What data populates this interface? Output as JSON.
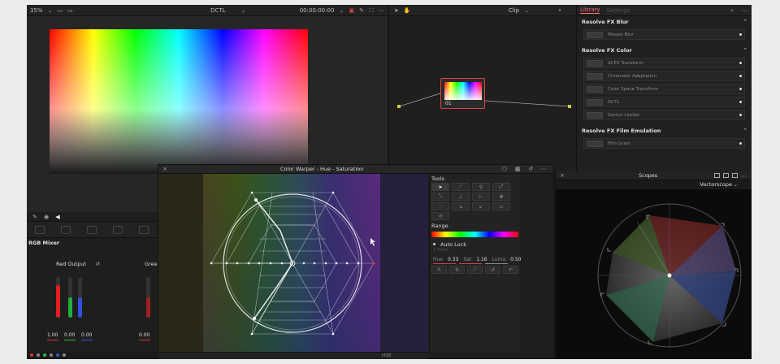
{
  "viewer": {
    "zoom": "35%",
    "title": "DCTL",
    "timecode": "00:00:00:00"
  },
  "nodes": {
    "title": "Clip",
    "node_label": "01"
  },
  "library": {
    "tab_active": "Library",
    "tab_inactive": "Settings",
    "sections": [
      {
        "title": "Resolve FX Blur",
        "items": [
          "Mosaic Blur"
        ]
      },
      {
        "title": "Resolve FX Color",
        "items": [
          "ACES Transform",
          "Chromatic Adaptation",
          "Color Space Transform",
          "DCTL",
          "Gamut Limiter"
        ]
      },
      {
        "title": "Resolve FX Film Emulation",
        "items": [
          "Film Grain"
        ]
      }
    ]
  },
  "mixer": {
    "title": "RGB Mixer",
    "red_output": "Red Output",
    "green_output": "Gree",
    "values": [
      "1.00",
      "0.00",
      "0.00"
    ],
    "values2": [
      "0.00"
    ]
  },
  "warper": {
    "title": "Color Warper - Hue - Saturation",
    "tools_label": "Tools",
    "range_label": "Range",
    "auto_lock": "Auto Lock",
    "focus": "1 Point",
    "hue_label": "Hue",
    "hue_value": "0.33",
    "sat_label": "Sat",
    "sat_value": "1.16",
    "luma_label": "Luma",
    "luma_value": "0.50",
    "bottom_label": "HSB"
  },
  "scopes": {
    "title": "Scopes",
    "mode": "Vectorscope"
  },
  "colors": {
    "accent": "#ff6b6b",
    "node_border": "#dd4444",
    "panel": "#1e1e1e"
  }
}
